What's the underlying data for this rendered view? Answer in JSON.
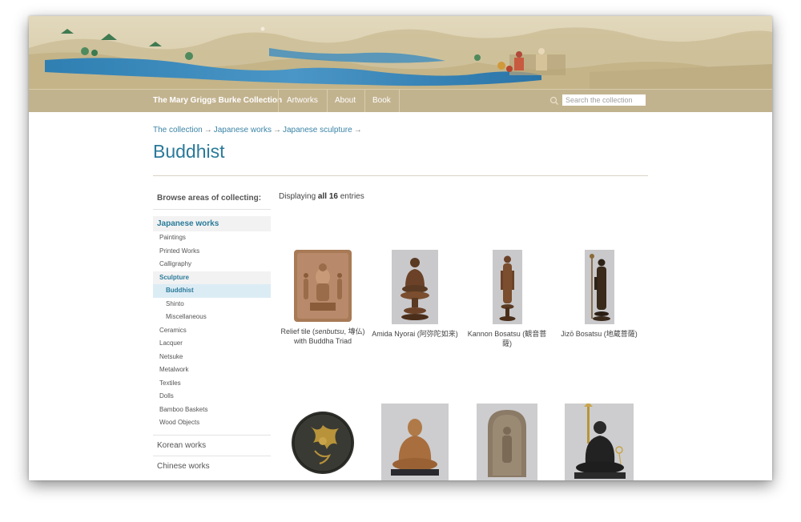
{
  "nav": {
    "site_title": "The Mary Griggs Burke Collection",
    "items": [
      {
        "label": "Artworks"
      },
      {
        "label": "About"
      },
      {
        "label": "Book"
      }
    ],
    "search_placeholder": "Search the collection"
  },
  "breadcrumb": {
    "items": [
      "The collection",
      "Japanese works",
      "Japanese sculpture"
    ],
    "separator": "→"
  },
  "page_title": "Buddhist",
  "sidebar": {
    "heading": "Browse areas of collecting:",
    "group_title": "Japanese works",
    "subitems": [
      {
        "label": "Paintings"
      },
      {
        "label": "Printed Works"
      },
      {
        "label": "Calligraphy"
      },
      {
        "label": "Sculpture"
      },
      {
        "label": "Buddhist"
      },
      {
        "label": "Shinto"
      },
      {
        "label": "Miscellaneous"
      },
      {
        "label": "Ceramics"
      },
      {
        "label": "Lacquer"
      },
      {
        "label": "Netsuke"
      },
      {
        "label": "Metalwork"
      },
      {
        "label": "Textiles"
      },
      {
        "label": "Dolls"
      },
      {
        "label": "Bamboo Baskets"
      },
      {
        "label": "Wood Objects"
      }
    ],
    "other_groups": [
      {
        "label": "Korean works"
      },
      {
        "label": "Chinese works"
      }
    ]
  },
  "results": {
    "prefix": "Displaying ",
    "count_text": "all 16",
    "suffix": " entries"
  },
  "artworks": [
    {
      "title_pre": "Relief tile (",
      "title_em": "senbutsu",
      "title_post": ", 塼仏) with Buddha Triad"
    },
    {
      "title_pre": "Amida Nyorai (阿弥陀如来)",
      "title_em": "",
      "title_post": ""
    },
    {
      "title_pre": "Kannon Bosatsu (観音菩薩)",
      "title_em": "",
      "title_post": ""
    },
    {
      "title_pre": "Jizō Bosatsu (地蔵菩薩)",
      "title_em": "",
      "title_post": ""
    },
    {
      "title_pre": "",
      "title_em": "",
      "title_post": ""
    },
    {
      "title_pre": "",
      "title_em": "",
      "title_post": ""
    },
    {
      "title_pre": "",
      "title_em": "",
      "title_post": ""
    },
    {
      "title_pre": "",
      "title_em": "",
      "title_post": ""
    }
  ],
  "colors": {
    "accent": "#2a7a9a",
    "nav_bg": "#c2b38f",
    "link": "#3a84a6"
  }
}
